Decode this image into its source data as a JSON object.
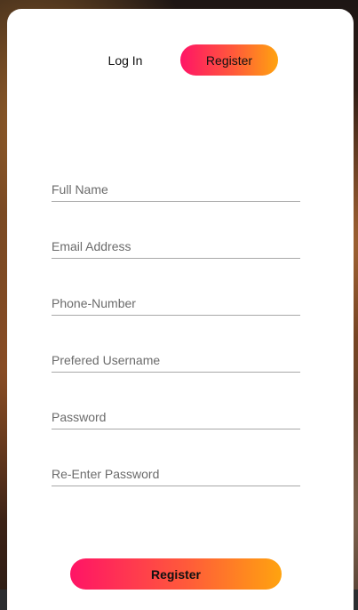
{
  "tabs": {
    "login_label": "Log In",
    "register_label": "Register"
  },
  "form": {
    "fields": [
      {
        "placeholder": "Full Name",
        "value": ""
      },
      {
        "placeholder": "Email Address",
        "value": ""
      },
      {
        "placeholder": "Phone-Number",
        "value": ""
      },
      {
        "placeholder": "Prefered Username",
        "value": ""
      },
      {
        "placeholder": "Password",
        "value": ""
      },
      {
        "placeholder": "Re-Enter Password",
        "value": ""
      }
    ],
    "submit_label": "Register"
  },
  "colors": {
    "accent_start": "#ff1466",
    "accent_end": "#ffa30f",
    "card_background": "#ffffff"
  }
}
